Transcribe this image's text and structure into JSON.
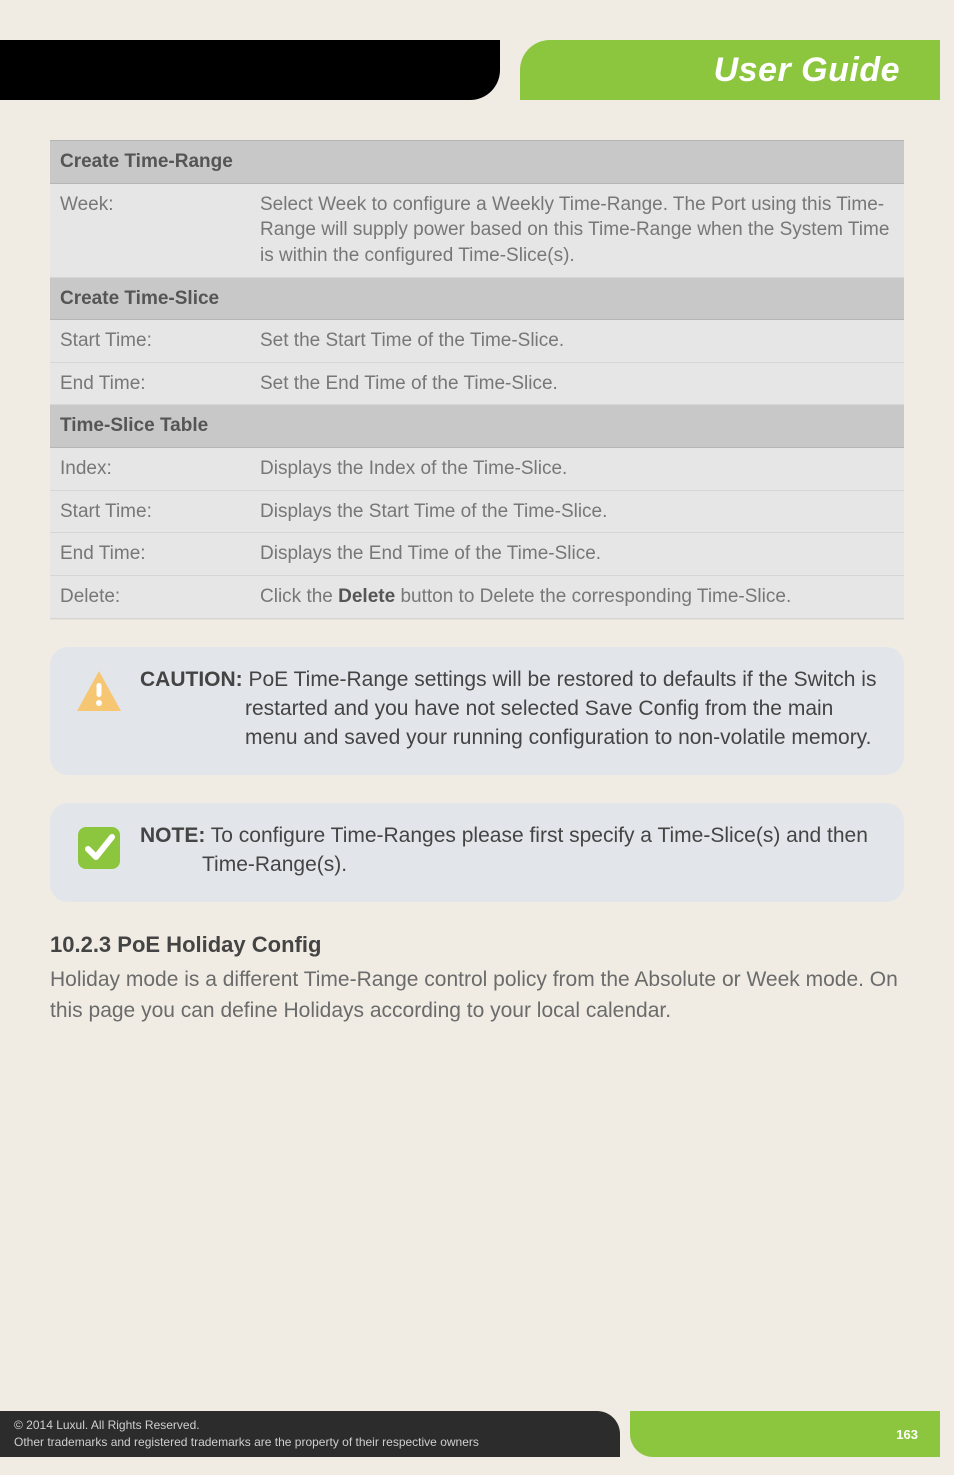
{
  "banner": {
    "title": "User Guide"
  },
  "table": {
    "sections": [
      {
        "heading": "Create Time-Range",
        "rows": [
          {
            "label": "Week:",
            "desc": "Select Week to configure a Weekly Time-Range. The Port using this Time-Range will supply power based on this Time-Range when the System Time is within the configured Time-Slice(s)."
          }
        ]
      },
      {
        "heading": "Create Time-Slice",
        "rows": [
          {
            "label": "Start Time:",
            "desc": "Set the Start Time of the Time-Slice."
          },
          {
            "label": "End Time:",
            "desc": "Set the End Time of the Time-Slice."
          }
        ]
      },
      {
        "heading": "Time-Slice Table",
        "rows": [
          {
            "label": "Index:",
            "desc": "Displays the Index of the Time-Slice."
          },
          {
            "label": "Start Time:",
            "desc": "Displays the Start Time of the Time-Slice."
          },
          {
            "label": "End Time:",
            "desc": "Displays the End Time of the Time-Slice."
          },
          {
            "label": "Delete:",
            "desc_prefix": "Click the ",
            "desc_bold": "Delete",
            "desc_suffix": " button to Delete the corresponding Time-Slice."
          }
        ]
      }
    ]
  },
  "caution": {
    "lead": "CAUTION:",
    "body": " PoE Time-Range settings will be restored to defaults if the Switch is restarted and you have not selected Save Config from the main menu and saved your running configuration to non-volatile memory."
  },
  "note": {
    "lead": "NOTE:",
    "body": " To configure Time-Ranges please first specify a Time-Slice(s) and then Time-Range(s)."
  },
  "section_heading": "10.2.3 PoE Holiday Config",
  "section_body": "Holiday mode is a different Time-Range control policy from the Absolute or Week mode. On this page you can define Holidays according to your local calendar.",
  "footer": {
    "line1": "© 2014  Luxul. All Rights Reserved.",
    "line2": "Other trademarks and registered trademarks are the property of their respective owners",
    "page": "163"
  }
}
